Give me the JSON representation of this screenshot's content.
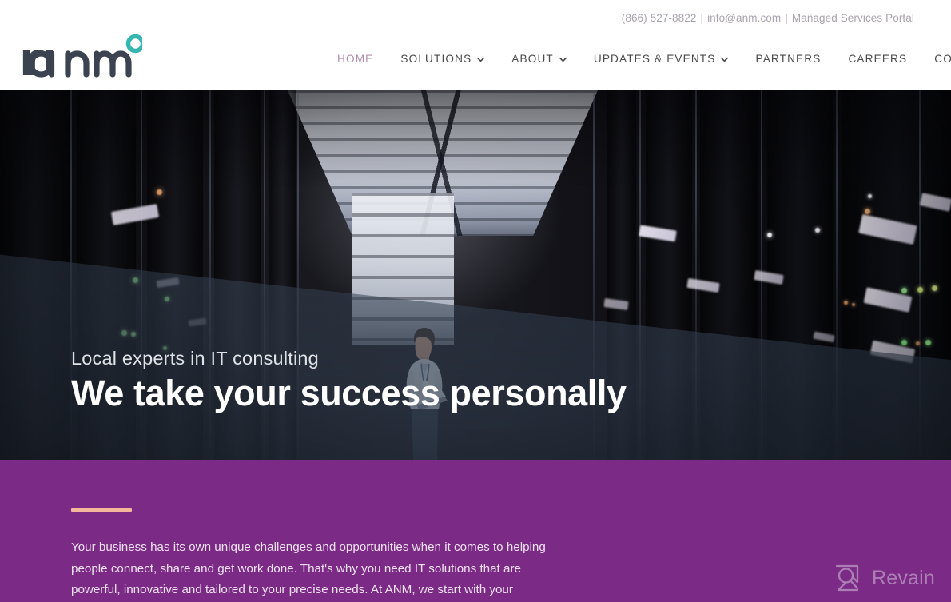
{
  "colors": {
    "purple_section": "#7b2a85",
    "accent_bar": "#f4b79c",
    "nav_active": "#b08fae",
    "nav_text": "#4a4a4a",
    "topbar_text": "#a9a3ad",
    "logo_dark": "#3b4351",
    "logo_teal": "#35b6b0",
    "watermark_text": "#cbb3d2"
  },
  "topbar": {
    "phone": "(866) 527-8822",
    "separator_1": "|",
    "email": "info@anm.com",
    "separator_2": "|",
    "portal_link": "Managed Services Portal"
  },
  "logo": {
    "wordmark": "anm",
    "icon_name": "anm-dot-ring-icon"
  },
  "nav": {
    "items": [
      {
        "label": "HOME",
        "active": true,
        "has_caret": false
      },
      {
        "label": "SOLUTIONS",
        "active": false,
        "has_caret": true
      },
      {
        "label": "ABOUT",
        "active": false,
        "has_caret": true
      },
      {
        "label": "UPDATES & EVENTS",
        "active": false,
        "has_caret": true
      },
      {
        "label": "PARTNERS",
        "active": false,
        "has_caret": false
      },
      {
        "label": "CAREERS",
        "active": false,
        "has_caret": false
      },
      {
        "label": "CONTACT",
        "active": false,
        "has_caret": false
      }
    ]
  },
  "hero": {
    "kicker": "Local experts in IT consulting",
    "headline": "We take your success personally",
    "image_description": "Woman with laptop standing in a dark data center server aisle"
  },
  "intro": {
    "body": "Your business has its own unique challenges and opportunities when it comes to helping people connect, share and get work done. That's why you need IT solutions that are powerful, innovative and tailored to your precise needs. At ANM, we start with your"
  },
  "watermark": {
    "label": "Revain",
    "icon_name": "revain-logo-icon"
  }
}
